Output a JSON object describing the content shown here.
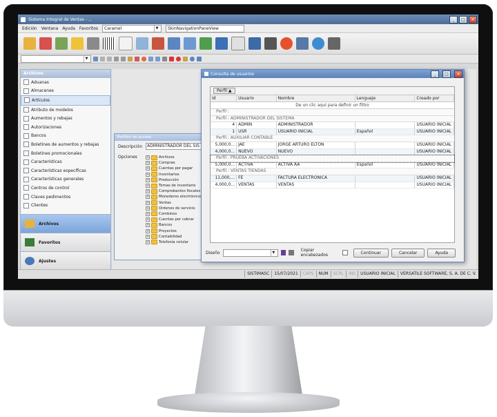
{
  "window": {
    "title": "Sistema Integral de Ventas - ... "
  },
  "menu": [
    "Edición",
    "Ventana",
    "Ayuda",
    "Favoritos"
  ],
  "skin_combo": "Caramel",
  "skin_combo2": "SkinNavigationPaneView",
  "nav": {
    "header": "Archivos",
    "items": [
      "Aduanas",
      "Almacenes",
      "Artículos",
      "Atributo de modelos",
      "Aumentos y rebajas",
      "Autorizaciones",
      "Bancos",
      "Boletines de aumentos y rebajas",
      "Boletines promocionales",
      "Características",
      "Características específicas",
      "Características generales",
      "Centros de control",
      "Claves pedimentos",
      "Clientes"
    ],
    "selected_index": 2,
    "buttons": [
      "Archivos",
      "Favoritos",
      "Ajustes"
    ]
  },
  "perfiles": {
    "title": "Perfiles de acceso",
    "descripcion_label": "Descripción",
    "descripcion_value": "ADMINISTRADOR DEL SIS",
    "opciones_label": "Opciones",
    "tree": [
      "Archivos",
      "Compras",
      "Cuentas por pagar",
      "Inventarios",
      "Producción",
      "Tomas de inventario",
      "Comprobantes fiscales",
      "Monederos electrónicos",
      "Ventas",
      "Ordenes de servicio",
      "Combines",
      "Cuentas por cobrar",
      "Bancos",
      "Proyectos",
      "Contabilidad",
      "Telefonía celular"
    ]
  },
  "consulta": {
    "title": "Consulta de usuarios",
    "perfil_chip": "Perfil",
    "columns": [
      "Id",
      "Usuario",
      "Nombre",
      "Lenguaje",
      "Creado por"
    ],
    "filter_text": "De un clic aquí para definir un filtro",
    "groups": [
      {
        "label": "Perfil :",
        "rows": []
      },
      {
        "label": "Perfil : ADMINISTRADOR DEL SISTEMA",
        "rows": [
          {
            "id": "4",
            "usuario": "ADMIN",
            "nombre": "ADMINISTRADOR",
            "lenguaje": "",
            "creado": "USUARIO INICIAL"
          },
          {
            "id": "1",
            "usuario": "USR",
            "nombre": "USUARIO INICIAL",
            "lenguaje": "Español",
            "creado": "USUARIO INICIAL"
          }
        ]
      },
      {
        "label": "Perfil : AUXILIAR CONTABLE",
        "rows": [
          {
            "id": "5,000,0...",
            "usuario": "JAE",
            "nombre": "JORGE ARTURO ELTON",
            "lenguaje": "",
            "creado": "USUARIO INICIAL"
          },
          {
            "id": "4,000,0...",
            "usuario": "NUEVO",
            "nombre": "NUEVO",
            "lenguaje": "",
            "creado": "USUARIO INICIAL"
          }
        ]
      },
      {
        "label": "Perfil : PRUEBA ACTIVACIONES",
        "rows": [
          {
            "id": "5,000,0...",
            "usuario": "ACTIVA",
            "nombre": "ACTIVA AA",
            "lenguaje": "Español",
            "creado": "USUARIO INICIAL"
          }
        ]
      },
      {
        "label": "Perfil : VENTAS TIENDAS",
        "rows": [
          {
            "id": "11,000,...",
            "usuario": "FE",
            "nombre": "FACTURA ELECTRONICA",
            "lenguaje": "",
            "creado": "USUARIO INICIAL"
          },
          {
            "id": "4,000,0...",
            "usuario": "VENTAS",
            "nombre": "VENTAS",
            "lenguaje": "",
            "creado": "USUARIO INICIAL"
          }
        ]
      }
    ],
    "diseno_label": "Diseño",
    "copiar_label": "Copiar encabezados",
    "buttons": [
      "Continuar",
      "Cancelar",
      "Ayuda"
    ]
  },
  "status": [
    "SISTIMASC",
    "15/07/2021",
    "CAPS",
    "NUM",
    "SCRL",
    "INS",
    "USUARIO INICIAL",
    "VERSATILE SOFTWARE, S. A. DE C. V."
  ]
}
